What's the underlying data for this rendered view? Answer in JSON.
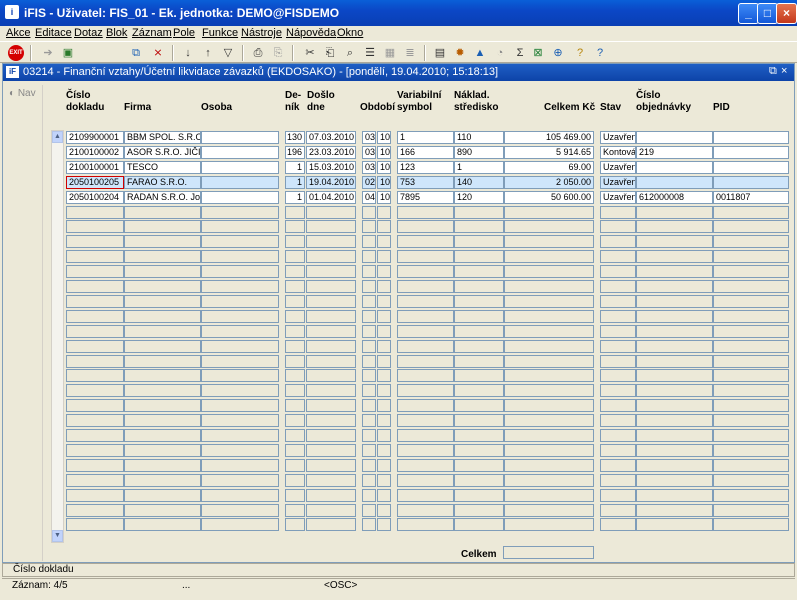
{
  "window": {
    "title": "iFIS - Uživatel: FIS_01 - Ek. jednotka: DEMO@FISDEMO",
    "minimize": "_",
    "maximize": "□",
    "close": "×"
  },
  "menu": [
    "Akce",
    "Editace",
    "Dotaz",
    "Blok",
    "Záznam",
    "Pole",
    "Funkce",
    "Nástroje",
    "Nápověda",
    "Okno"
  ],
  "toolbar_icons": [
    "exit-icon",
    "forward-icon",
    "save-icon",
    "copy-record-icon",
    "delete-record-icon",
    "sort-asc-icon",
    "sort-desc-icon",
    "filter-icon",
    "print-icon",
    "print-preview-icon",
    "cut-icon",
    "paste-icon",
    "search-icon",
    "list-icon",
    "calculator-icon",
    "settings-icon",
    "warning-icon",
    "clock-icon",
    "sum-icon",
    "excel-icon",
    "export-icon",
    "help-icon",
    "info-icon"
  ],
  "form": {
    "title": "03214 - Finanční vztahy/Účetní likvidace závazků (EKDOSAKO) - [pondělí, 19.04.2010; 15:18:13]",
    "title_btns": [
      "⧉",
      "×"
    ],
    "nav_label": "Nav"
  },
  "columns": {
    "cislo_dokladu": "Číslo\ndokladu",
    "firma": "Firma",
    "osoba": "Osoba",
    "denik": "De-\nník",
    "doslo_dne": "Došlo\ndne",
    "obdobi": "Období",
    "variabilni_symbol": "Variabilní\nsymbol",
    "naklad_stredisko": "Náklad.\nstředisko",
    "celkem_kc": "Celkem Kč",
    "stav": "Stav",
    "cislo_objednavky": "Číslo\nobjednávky",
    "pid": "PID"
  },
  "rows": [
    {
      "cislo": "2109900001",
      "firma": "BBM SPOL. S.R.O.",
      "osoba": "",
      "denik": "130",
      "doslo": "07.03.2010",
      "obd1": "03",
      "obd2": "10",
      "vs": "1",
      "ns": "110",
      "celkem": "105 469.00",
      "stav": "Uzavřen",
      "objednavka": "",
      "pid": ""
    },
    {
      "cislo": "2100100002",
      "firma": "ASOR S.R.O. JIČIN",
      "osoba": "",
      "denik": "196",
      "doslo": "23.03.2010",
      "obd1": "03",
      "obd2": "10",
      "vs": "166",
      "ns": "890",
      "celkem": "5 914.65",
      "stav": "Kontová",
      "objednavka": "219",
      "pid": ""
    },
    {
      "cislo": "2100100001",
      "firma": "TESCO",
      "osoba": "",
      "denik": "1",
      "doslo": "15.03.2010",
      "obd1": "03",
      "obd2": "10",
      "vs": "123",
      "ns": "1",
      "celkem": "69.00",
      "stav": "Uzavřen",
      "objednavka": "",
      "pid": ""
    },
    {
      "cislo": "2050100205",
      "firma": "FARAO S.R.O.",
      "osoba": "",
      "denik": "1",
      "doslo": "19.04.2010",
      "obd1": "02",
      "obd2": "10",
      "vs": "753",
      "ns": "140",
      "celkem": "2 050.00",
      "stav": "Uzavřen",
      "objednavka": "",
      "pid": ""
    },
    {
      "cislo": "2050100204",
      "firma": "RADAN S.R.O. Jose",
      "osoba": "",
      "denik": "1",
      "doslo": "01.04.2010",
      "obd1": "04",
      "obd2": "10",
      "vs": "7895",
      "ns": "120",
      "celkem": "50 600.00",
      "stav": "Uzavřen",
      "objednavka": "612000008",
      "pid": "0011807"
    }
  ],
  "selected_row": 3,
  "celkem_label": "Celkem",
  "celkem_value": "",
  "status": {
    "field_hint": "Číslo dokladu",
    "record": "Záznam: 4/5",
    "seg2": "...",
    "mode": "<OSC>"
  }
}
